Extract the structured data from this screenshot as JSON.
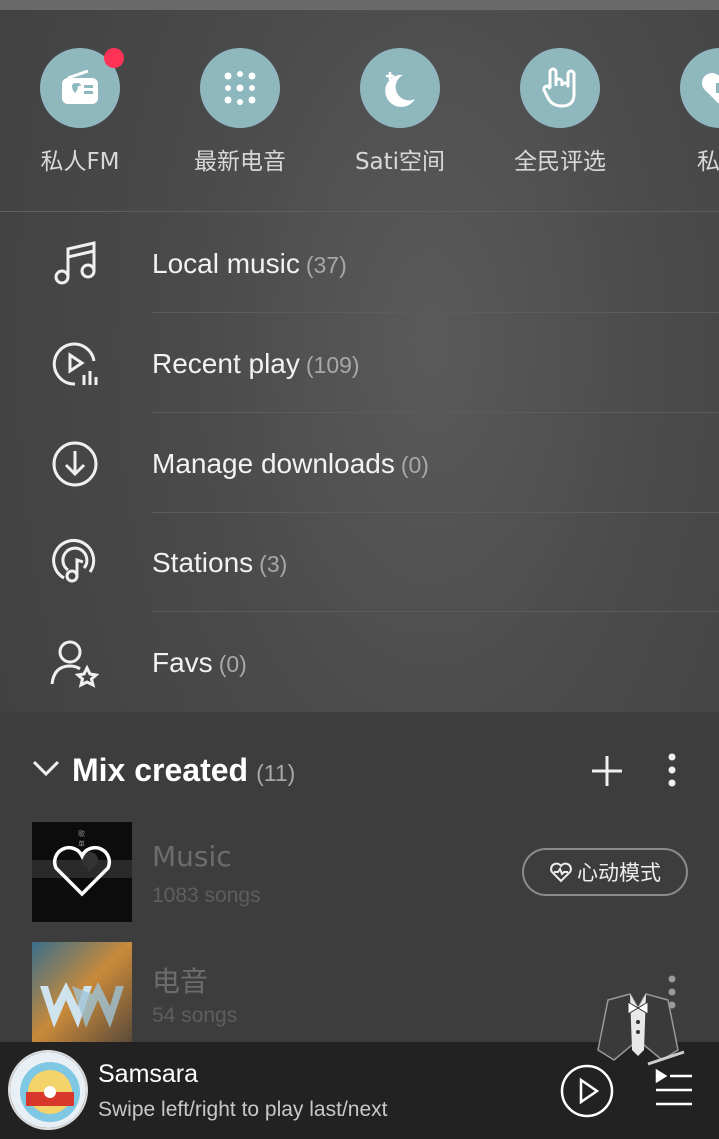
{
  "shortcuts": [
    {
      "label": "私人FM",
      "icon": "radio-icon",
      "badge": true
    },
    {
      "label": "最新电音",
      "icon": "dots-grid-icon",
      "badge": false
    },
    {
      "label": "Sati空间",
      "icon": "moon-icon",
      "badge": false
    },
    {
      "label": "全民评选",
      "icon": "rock-hand-icon",
      "badge": false
    },
    {
      "label": "私藏",
      "icon": "heart-icon",
      "badge": false
    }
  ],
  "menu": [
    {
      "label": "Local music",
      "count": "(37)",
      "icon": "music-note-icon"
    },
    {
      "label": "Recent play",
      "count": "(109)",
      "icon": "recent-play-icon"
    },
    {
      "label": "Manage downloads",
      "count": "(0)",
      "icon": "download-icon"
    },
    {
      "label": "Stations",
      "count": "(3)",
      "icon": "station-icon"
    },
    {
      "label": "Favs",
      "count": "(0)",
      "icon": "person-star-icon"
    }
  ],
  "mix": {
    "title": "Mix created",
    "count": "(11)",
    "playlists": [
      {
        "name": "Music",
        "songs": "1083 songs",
        "action": "心动模式"
      },
      {
        "name": "电音",
        "songs": "54 songs"
      }
    ]
  },
  "player": {
    "song": "Samsara",
    "hint": "Swipe left/right to play last/next"
  },
  "colors": {
    "accent_circle": "#8fb7be",
    "badge": "#ff3355",
    "background": "#4a4a4a"
  }
}
